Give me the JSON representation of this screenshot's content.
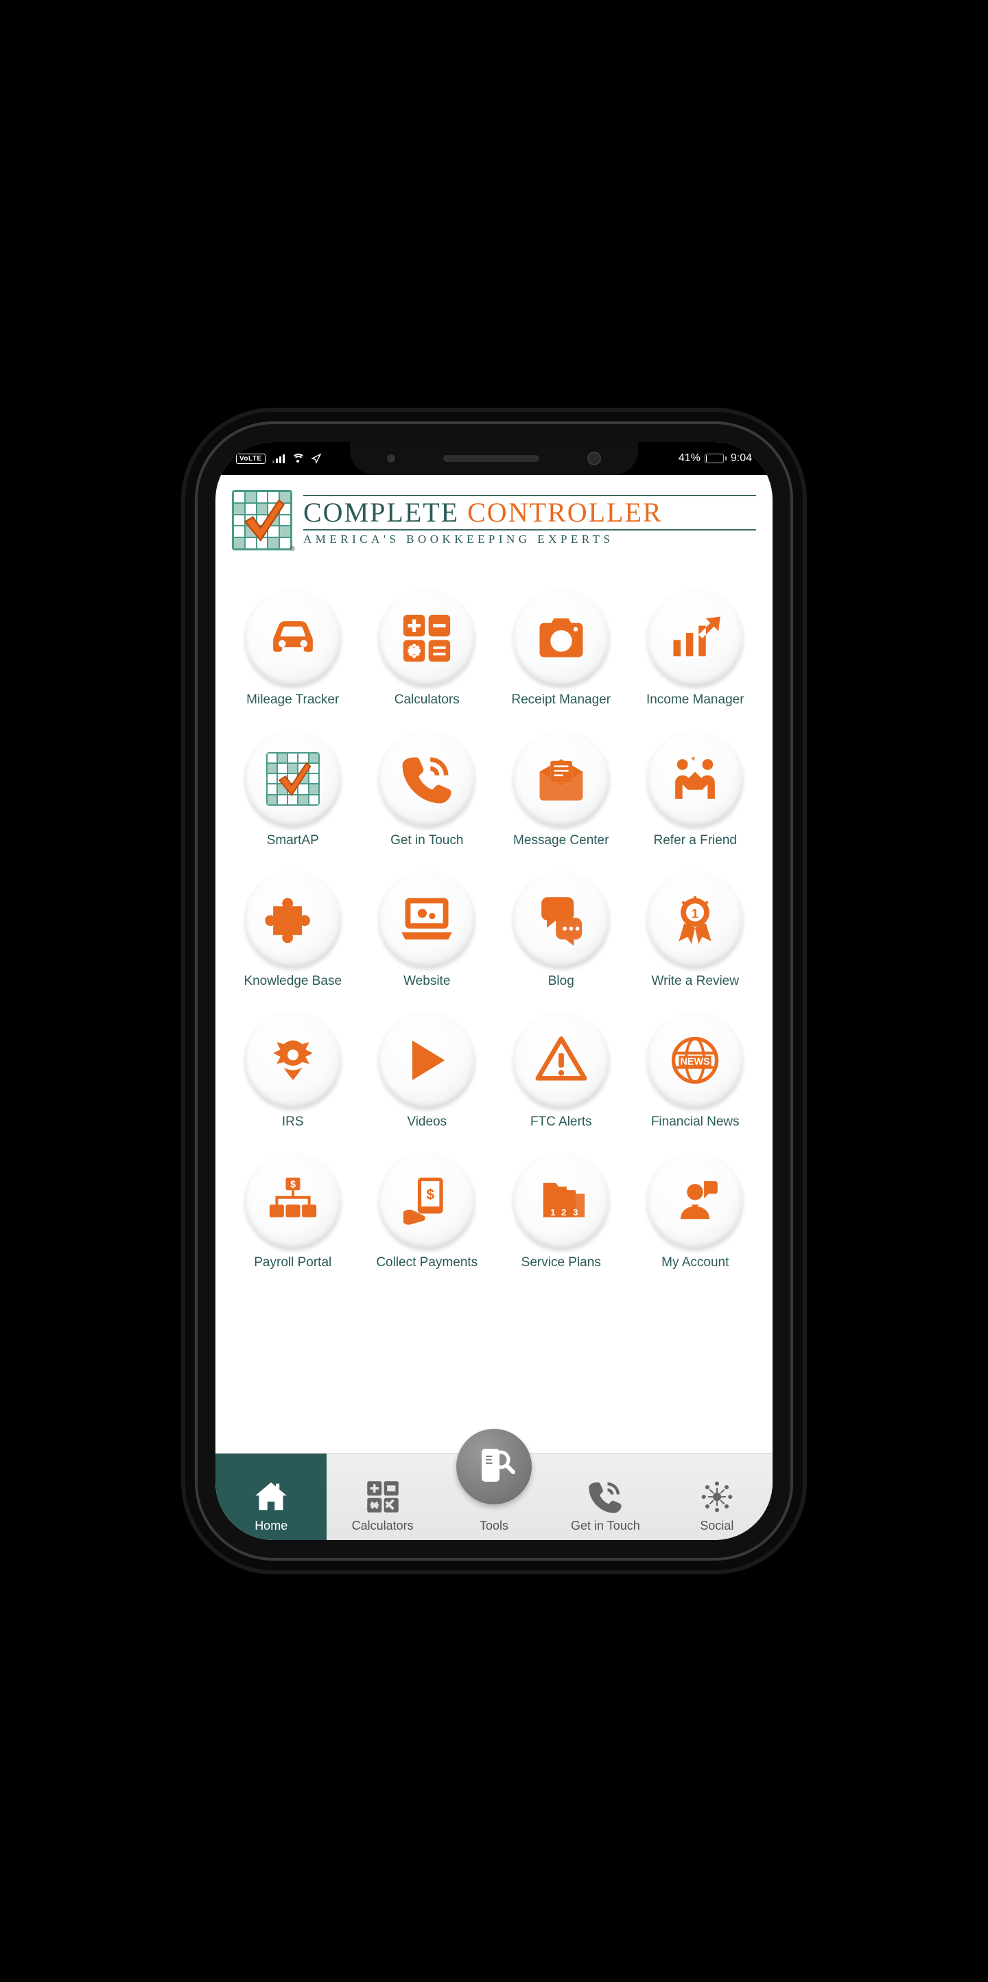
{
  "status": {
    "volte": "VoLTE",
    "battery_pct": "41%",
    "time": "9:04"
  },
  "header": {
    "brand_word1": "COMPLETE",
    "brand_word2": "CONTROLLER",
    "tagline": "America's Bookkeeping Experts"
  },
  "tiles": [
    {
      "id": "mileage-tracker",
      "label": "Mileage Tracker",
      "icon": "car"
    },
    {
      "id": "calculators",
      "label": "Calculators",
      "icon": "calc-keys"
    },
    {
      "id": "receipt-manager",
      "label": "Receipt Manager",
      "icon": "camera"
    },
    {
      "id": "income-manager",
      "label": "Income Manager",
      "icon": "chart-up"
    },
    {
      "id": "smartap",
      "label": "SmartAP",
      "icon": "smartap-logo"
    },
    {
      "id": "get-in-touch",
      "label": "Get in Touch",
      "icon": "phone-ring"
    },
    {
      "id": "message-center",
      "label": "Message Center",
      "icon": "mail-letter"
    },
    {
      "id": "refer-a-friend",
      "label": "Refer a Friend",
      "icon": "high-five"
    },
    {
      "id": "knowledge-base",
      "label": "Knowledge Base",
      "icon": "puzzle"
    },
    {
      "id": "website",
      "label": "Website",
      "icon": "laptop-gears"
    },
    {
      "id": "blog",
      "label": "Blog",
      "icon": "chat-bubbles"
    },
    {
      "id": "write-a-review",
      "label": "Write a Review",
      "icon": "award-ribbon"
    },
    {
      "id": "irs",
      "label": "IRS",
      "icon": "irs-eagle"
    },
    {
      "id": "videos",
      "label": "Videos",
      "icon": "play"
    },
    {
      "id": "ftc-alerts",
      "label": "FTC Alerts",
      "icon": "warning"
    },
    {
      "id": "financial-news",
      "label": "Financial News",
      "icon": "globe-news"
    },
    {
      "id": "payroll-portal",
      "label": "Payroll Portal",
      "icon": "org-dollar"
    },
    {
      "id": "collect-payments",
      "label": "Collect Payments",
      "icon": "hand-tablet-dollar"
    },
    {
      "id": "service-plans",
      "label": "Service Plans",
      "icon": "folders-123"
    },
    {
      "id": "my-account",
      "label": "My Account",
      "icon": "account-speak"
    }
  ],
  "nav": [
    {
      "id": "home",
      "label": "Home",
      "icon": "house",
      "active": true
    },
    {
      "id": "calculators",
      "label": "Calculators",
      "icon": "calc-keys",
      "active": false
    },
    {
      "id": "tools",
      "label": "Tools",
      "icon": "phone-search",
      "active": false,
      "center": true
    },
    {
      "id": "get-in-touch",
      "label": "Get in Touch",
      "icon": "phone-ring",
      "active": false
    },
    {
      "id": "social",
      "label": "Social",
      "icon": "network",
      "active": false
    }
  ],
  "colors": {
    "orange": "#e86b1f",
    "teal": "#2a5a58"
  }
}
